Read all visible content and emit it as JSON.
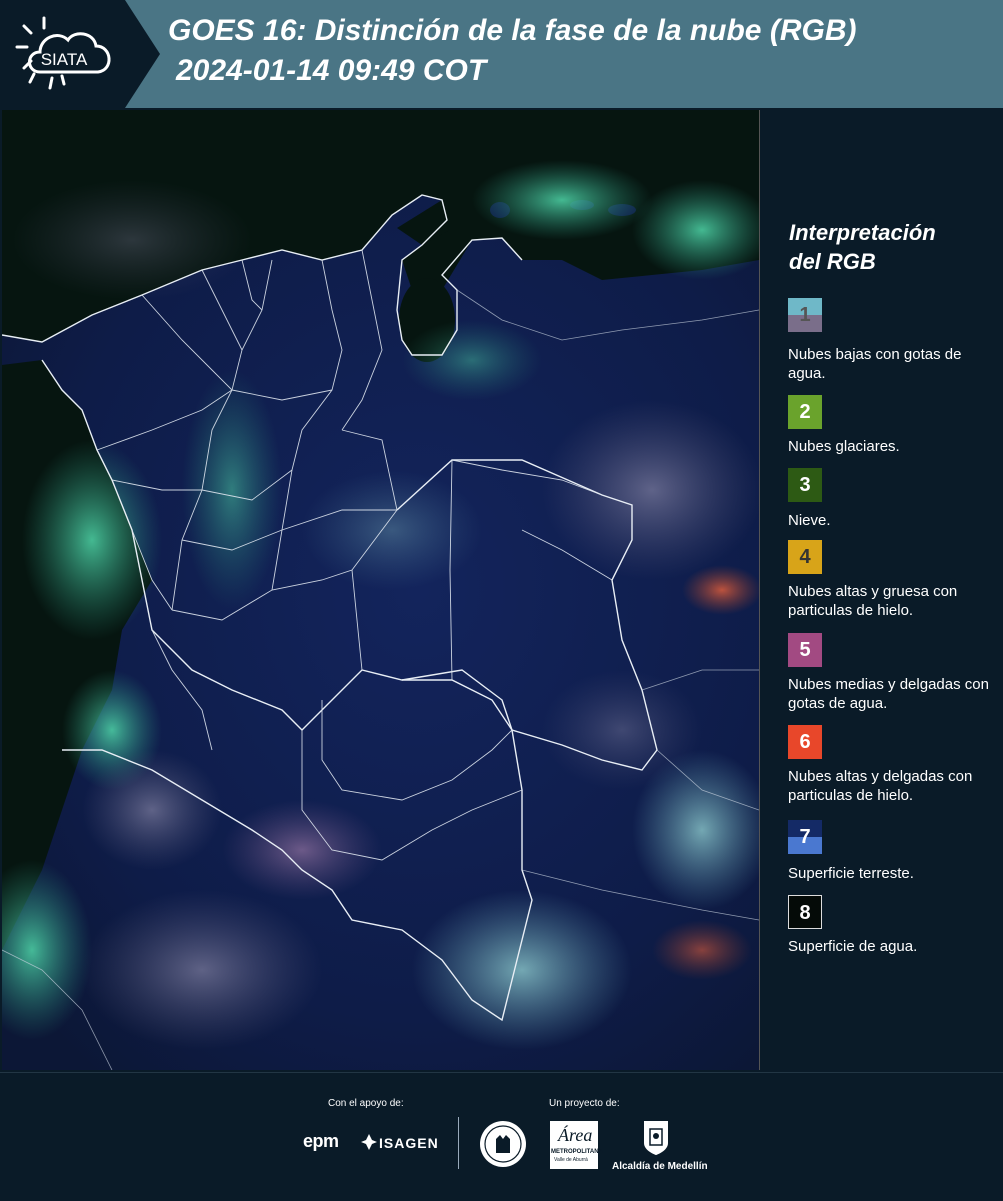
{
  "header": {
    "logo_text": "SIATA",
    "title": "GOES 16: Distinción de la fase de la nube (RGB)",
    "subtitle": "2024-01-14 09:49 COT"
  },
  "legend": {
    "title_line1": "Interpretación",
    "title_line2": "del RGB",
    "items": [
      {
        "number": "1",
        "label": "Nubes bajas con gotas de agua.",
        "color_top": "#6fb8c8",
        "color_bottom": "#7a6e8a"
      },
      {
        "number": "2",
        "label": "Nubes glaciares.",
        "color": "#6aa32c"
      },
      {
        "number": "3",
        "label": "Nieve.",
        "color": "#2d5a14"
      },
      {
        "number": "4",
        "label": "Nubes altas y gruesa con particulas de hielo.",
        "color": "#d8a419"
      },
      {
        "number": "5",
        "label": "Nubes medias y delgadas con gotas de agua.",
        "color": "#a24a82"
      },
      {
        "number": "6",
        "label": "Nubes altas y delgadas con particulas de hielo.",
        "color": "#e8472a"
      },
      {
        "number": "7",
        "label": "Superficie terreste.",
        "color_top": "#142a66",
        "color_bottom": "#4a78d0"
      },
      {
        "number": "8",
        "label": "Superficie de agua.",
        "color": "#050b08"
      }
    ]
  },
  "footer": {
    "support_caption": "Con el apoyo de:",
    "project_caption": "Un proyecto de:",
    "sponsor_epm": "epm",
    "sponsor_isagen": "ISAGEN",
    "partner_area_main": "Área",
    "partner_area_sub1": "METROPOLITANA",
    "partner_area_sub2": "Valle de Aburrá",
    "partner_alcaldia": "Alcaldía de Medellín"
  },
  "colors": {
    "header_bg": "#4a7585",
    "page_bg": "#0a1b28",
    "ocean": "#061510",
    "land": "#0e1c48"
  }
}
